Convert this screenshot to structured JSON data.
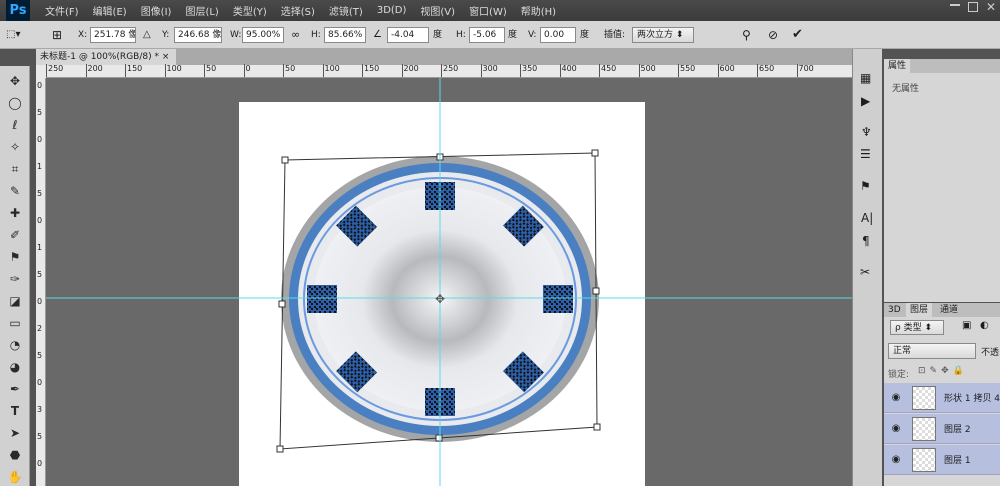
{
  "app": {
    "logo": "Ps"
  },
  "menu": [
    "文件(F)",
    "编辑(E)",
    "图像(I)",
    "图层(L)",
    "类型(Y)",
    "选择(S)",
    "滤镜(T)",
    "3D(D)",
    "视图(V)",
    "窗口(W)",
    "帮助(H)"
  ],
  "options": {
    "x_label": "X:",
    "x_value": "251.78 像",
    "y_label": "Y:",
    "y_value": "246.68 像",
    "w_label": "W:",
    "w_value": "95.00%",
    "h_label": "H:",
    "h_value": "85.66%",
    "angle_value": "-4.04",
    "angle_unit": "度",
    "hskew_label": "H:",
    "hskew_value": "-5.06",
    "hskew_unit": "度",
    "vskew_label": "V:",
    "vskew_value": "0.00",
    "vskew_unit": "度",
    "interp_label": "插值:",
    "interp_value": "两次立方"
  },
  "document": {
    "tab_title": "未标题-1 @ 100%(RGB/8) *"
  },
  "ruler_top": [
    "250",
    "200",
    "150",
    "100",
    "50",
    "0",
    "50",
    "100",
    "150",
    "200",
    "250",
    "300",
    "350",
    "400",
    "450",
    "500",
    "550",
    "600",
    "650",
    "700"
  ],
  "ruler_left": [
    "0",
    "5",
    "0",
    "1",
    "5",
    "0",
    "1",
    "5",
    "0",
    "2",
    "5",
    "0",
    "3",
    "5",
    "0"
  ],
  "properties": {
    "tab": "属性",
    "empty_text": "无属性"
  },
  "layers": {
    "tabs": [
      "3D",
      "图层",
      "通道"
    ],
    "filter_label": "ρ 类型",
    "blend_mode": "正常",
    "opacity_label": "不透",
    "lock_label": "锁定:",
    "items": [
      {
        "name": "形状 1 拷贝 4"
      },
      {
        "name": "图层 2"
      },
      {
        "name": "图层 1"
      }
    ]
  },
  "colors": {
    "accent_blue": "#4a7fc1",
    "guide": "#5fd8e8",
    "selection": "#b6bfde"
  }
}
